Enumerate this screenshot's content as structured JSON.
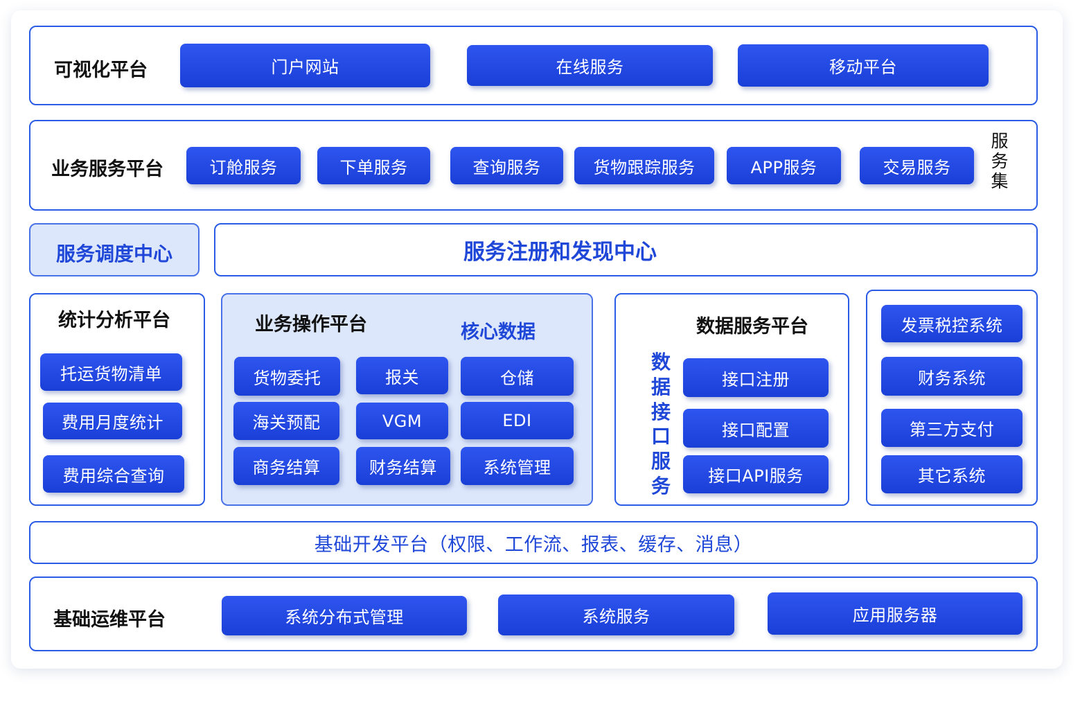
{
  "visualization": {
    "title": "可视化平台",
    "items": [
      "门户网站",
      "在线服务",
      "移动平台"
    ]
  },
  "business_service": {
    "title": "业务服务平台",
    "items": [
      "订舱服务",
      "下单服务",
      "查询服务",
      "货物跟踪服务",
      "APP服务",
      "交易服务"
    ],
    "side_label": [
      "服",
      "务",
      "集"
    ]
  },
  "dispatch_center": {
    "title": "服务调度中心"
  },
  "registry_center": {
    "title": "服务注册和发现中心"
  },
  "stats": {
    "title": "统计分析平台",
    "items": [
      "托运货物清单",
      "费用月度统计",
      "费用综合查询"
    ]
  },
  "operation": {
    "title": "业务操作平台",
    "core_label": "核心数据",
    "items": [
      "货物委托",
      "报关",
      "仓储",
      "海关预配",
      "VGM",
      "EDI",
      "商务结算",
      "财务结算",
      "系统管理"
    ]
  },
  "data_service": {
    "title": "数据服务平台",
    "side_label": [
      "数",
      "据",
      "接",
      "口",
      "服",
      "务"
    ],
    "items": [
      "接口注册",
      "接口配置",
      "接口API服务"
    ]
  },
  "external": {
    "items": [
      "发票税控系统",
      "财务系统",
      "第三方支付",
      "其它系统"
    ]
  },
  "base_dev": {
    "title": "基础开发平台（权限、工作流、报表、缓存、消息）"
  },
  "ops": {
    "title": "基础运维平台",
    "items": [
      "系统分布式管理",
      "系统服务",
      "应用服务器"
    ]
  },
  "colors": {
    "accent": "#1f47d8",
    "border": "#2a5ce6",
    "tint": "#dde7fb"
  }
}
